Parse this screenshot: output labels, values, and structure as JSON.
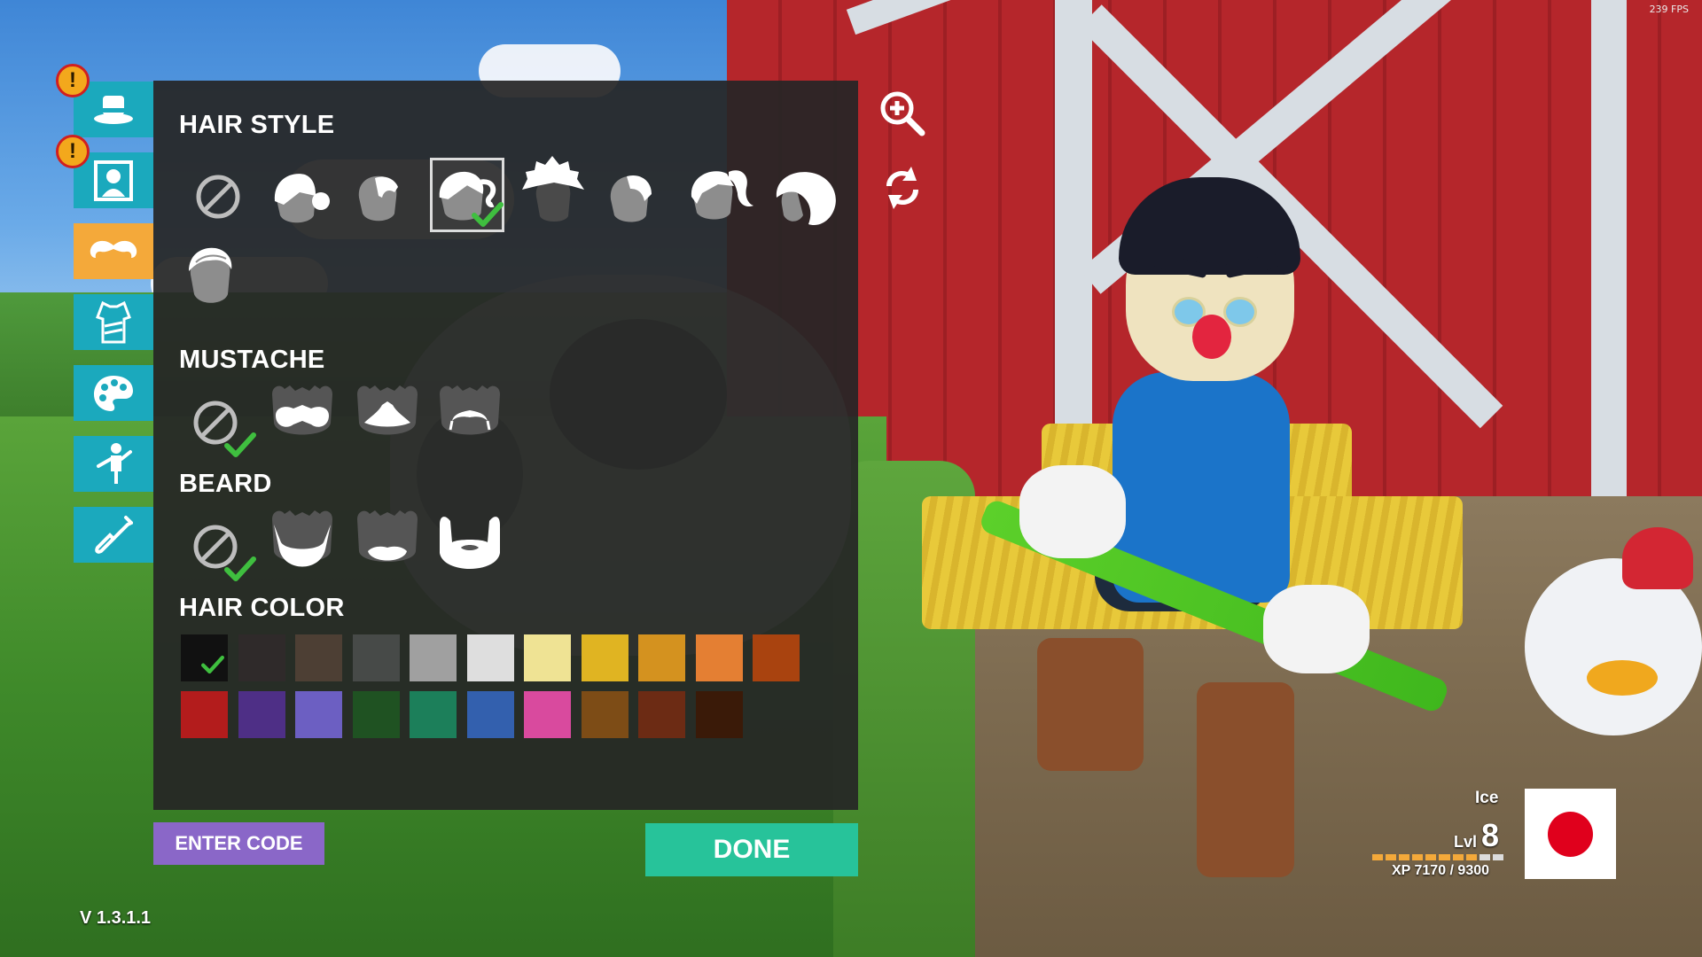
{
  "hud": {
    "fps": "239 FPS",
    "version": "V 1.3.1.1"
  },
  "colors": {
    "tab": "#1ba9bd",
    "tab_active": "#f4a93a",
    "check": "#3fbf3f",
    "done": "#27c39a",
    "code": "#8a67c8"
  },
  "tabs": [
    {
      "icon": "hat-icon",
      "alert": true
    },
    {
      "icon": "portrait-icon",
      "alert": true
    },
    {
      "icon": "mustache-icon",
      "active": true
    },
    {
      "icon": "shirt-icon"
    },
    {
      "icon": "palette-icon"
    },
    {
      "icon": "pose-icon"
    },
    {
      "icon": "shovel-icon"
    }
  ],
  "sections": {
    "hair_style": {
      "title": "HAIR STYLE",
      "options": [
        "none",
        "bun",
        "short",
        "ponytail-curl",
        "mohawk",
        "side-part",
        "ponytail",
        "helmet",
        "slick"
      ],
      "selected_index": 3
    },
    "mustache": {
      "title": "MUSTACHE",
      "options": [
        "none",
        "walrus",
        "chevron",
        "handlebar"
      ],
      "selected_index": 0
    },
    "beard": {
      "title": "BEARD",
      "options": [
        "none",
        "goatee",
        "chin-strap",
        "full"
      ],
      "selected_index": 0
    },
    "hair_color": {
      "title": "HAIR COLOR",
      "swatches": [
        "#111111",
        "#2f2a2a",
        "#4d3f34",
        "#474a48",
        "#a0a0a0",
        "#dedede",
        "#efe394",
        "#e0b422",
        "#d4921f",
        "#e47f33",
        "#a9430f",
        "#b31c1c",
        "#4e2f86",
        "#6c5fc2",
        "#1f5222",
        "#1c7f5a",
        "#3360ae",
        "#d94a9e",
        "#7d4c16",
        "#6c2b14",
        "#3a1a08"
      ],
      "selected_index": 0
    }
  },
  "buttons": {
    "enter_code": "ENTER CODE",
    "done": "DONE"
  },
  "player": {
    "name": "Ice",
    "level_label": "Lvl",
    "level": "8",
    "xp": "XP 7170 / 9300",
    "xp_progress": 0.771,
    "flag": "Japan"
  }
}
